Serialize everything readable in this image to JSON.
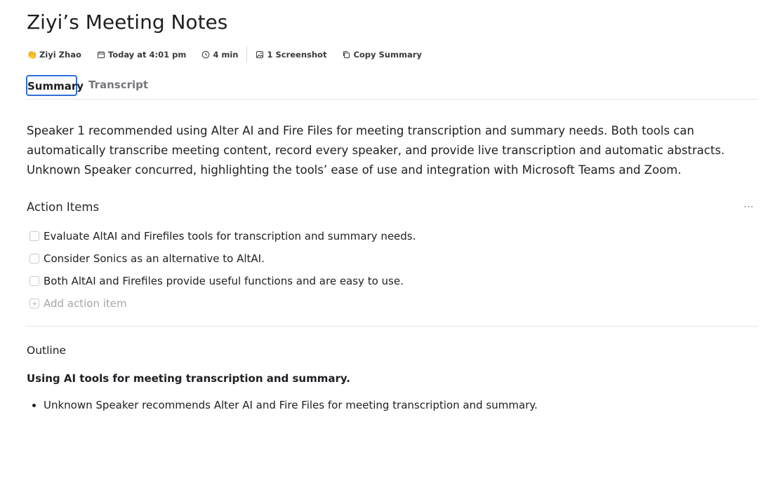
{
  "title": "Ziyi’s Meeting Notes",
  "meta": {
    "author": "Ziyi Zhao",
    "author_emoji": "👏",
    "date": "Today at 4:01 pm",
    "duration": "4 min",
    "screenshots": "1 Screenshot",
    "copy_summary": "Copy Summary"
  },
  "tabs": {
    "summary": "Summary",
    "transcript": "Transcript",
    "active": "Summary"
  },
  "summary_text": "Speaker 1 recommended using Alter AI and Fire Files for meeting transcription and summary needs. Both tools can automatically transcribe meeting content, record every speaker, and provide live transcription and automatic abstracts. Unknown Speaker concurred, highlighting the tools’ ease of use and integration with Microsoft Teams and Zoom.",
  "action_items": {
    "title": "Action Items",
    "more": "···",
    "items": [
      {
        "text": "Evaluate AltAI and Firefiles tools for transcription and summary needs.",
        "checked": false
      },
      {
        "text": "Consider Sonics as an alternative to AltAI.",
        "checked": false
      },
      {
        "text": "Both AltAI and Firefiles provide useful functions and are easy to use.",
        "checked": false
      }
    ],
    "add_label": "Add action item"
  },
  "outline": {
    "title": "Outline",
    "topic": "Using AI tools for meeting transcription and summary.",
    "bullets": [
      "Unknown Speaker recommends Alter AI and Fire Files for meeting transcription and summary."
    ]
  },
  "colors": {
    "accent": "#2f6fdc",
    "text": "#1f1f23",
    "muted": "#76767c",
    "divider": "#e6e6ea"
  }
}
